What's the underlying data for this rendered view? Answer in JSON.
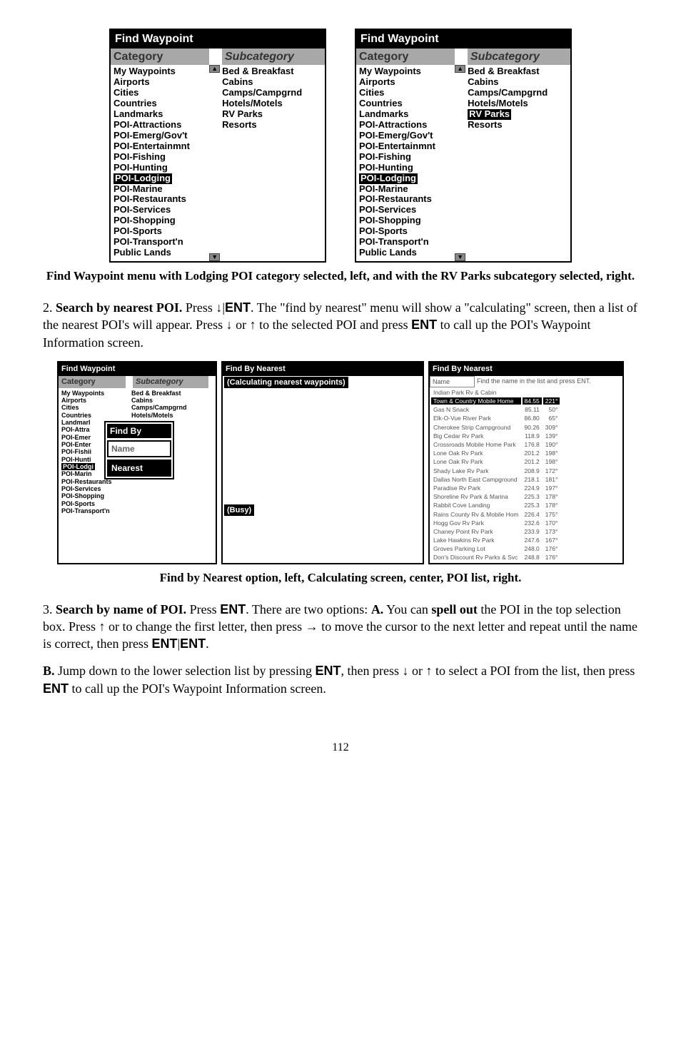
{
  "figure1": {
    "windows": [
      {
        "title": "Find Waypoint",
        "cat_header": "Category",
        "sub_header": "Subcategory",
        "categories": [
          "My Waypoints",
          "Airports",
          "Cities",
          "Countries",
          "Landmarks",
          "POI-Attractions",
          "POI-Emerg/Gov't",
          "POI-Entertainmnt",
          "POI-Fishing",
          "POI-Hunting",
          "POI-Lodging",
          "POI-Marine",
          "POI-Restaurants",
          "POI-Services",
          "POI-Shopping",
          "POI-Sports",
          "POI-Transport'n",
          "Public Lands"
        ],
        "cat_selected_index": 10,
        "subcategories": [
          "Bed & Breakfast",
          "Cabins",
          "Camps/Campgrnd",
          "Hotels/Motels",
          "RV Parks",
          "Resorts"
        ],
        "sub_selected_index": -1
      },
      {
        "title": "Find Waypoint",
        "cat_header": "Category",
        "sub_header": "Subcategory",
        "categories": [
          "My Waypoints",
          "Airports",
          "Cities",
          "Countries",
          "Landmarks",
          "POI-Attractions",
          "POI-Emerg/Gov't",
          "POI-Entertainmnt",
          "POI-Fishing",
          "POI-Hunting",
          "POI-Lodging",
          "POI-Marine",
          "POI-Restaurants",
          "POI-Services",
          "POI-Shopping",
          "POI-Sports",
          "POI-Transport'n",
          "Public Lands"
        ],
        "cat_selected_index": 10,
        "subcategories": [
          "Bed & Breakfast",
          "Cabins",
          "Camps/Campgrnd",
          "Hotels/Motels",
          "RV Parks",
          "Resorts"
        ],
        "sub_selected_index": 4
      }
    ],
    "caption": "Find Waypoint menu with Lodging POI category selected, left, and with the RV Parks subcategory selected, right."
  },
  "para1_before": "2. ",
  "para1_bold": "Search by nearest POI.",
  "para1_after1": " Press ↓|",
  "para1_ent1": "ENT",
  "para1_after2": ". The \"find by nearest\" menu will show a \"calculating\" screen, then a list of the nearest POI's will appear. Press ↓ or ↑ to the selected POI and press ",
  "para1_ent2": "ENT",
  "para1_after3": " to call up the POI's Waypoint Information screen.",
  "figure2": {
    "left": {
      "title": "Find Waypoint",
      "cat_header": "Category",
      "sub_header": "Subcategory",
      "categories": [
        "My Waypoints",
        "Airports",
        "Cities",
        "Countries",
        "Landmarl",
        "POI-Attra",
        "POI-Emer",
        "POI-Enter",
        "POI-Fishii",
        "POI-Hunti",
        "POI-Lodgi",
        "POI-Marin",
        "POI-Restaurants",
        "POI-Services",
        "POI-Shopping",
        "POI-Sports",
        "POI-Transport'n",
        "Public Lands"
      ],
      "subcategories": [
        "Bed & Breakfast",
        "Cabins",
        "Camps/Campgrnd",
        "Hotels/Motels"
      ],
      "popup_title": "Find By",
      "popup_items": [
        "Name",
        "Nearest"
      ],
      "popup_selected": 1
    },
    "center": {
      "title": "Find By Nearest",
      "status": "(Calculating nearest waypoints)",
      "busy": "(Busy)"
    },
    "right": {
      "title": "Find By Nearest",
      "name_label": "Name",
      "hint": "Find the name in the list and press ENT.",
      "rows": [
        {
          "name": "Indian Park Rv & Cabin",
          "dist": "",
          "brg": ""
        },
        {
          "name": "Town & Country Mobile Home",
          "dist": "84.55",
          "brg": "221°",
          "sel": true
        },
        {
          "name": "Gas N Snack",
          "dist": "85.11",
          "brg": "50°"
        },
        {
          "name": "Elk-O-Vue River Park",
          "dist": "86.80",
          "brg": "65°"
        },
        {
          "name": "Cherokee Strip Campground",
          "dist": "90.26",
          "brg": "309°"
        },
        {
          "name": "Big Cedar Rv Park",
          "dist": "118.9",
          "brg": "139°"
        },
        {
          "name": "Crossroads Mobile Home Park",
          "dist": "176.8",
          "brg": "190°"
        },
        {
          "name": "Lone Oak Rv Park",
          "dist": "201.2",
          "brg": "198°"
        },
        {
          "name": "Lone Oak Rv Park",
          "dist": "201.2",
          "brg": "198°"
        },
        {
          "name": "Shady Lake Rv Park",
          "dist": "208.9",
          "brg": "172°"
        },
        {
          "name": "Dallas North East Campground",
          "dist": "218.1",
          "brg": "181°"
        },
        {
          "name": "Paradise Rv Park",
          "dist": "224.9",
          "brg": "197°"
        },
        {
          "name": "Shoreline Rv Park & Marina",
          "dist": "225.3",
          "brg": "178°"
        },
        {
          "name": "Rabbit Cove Landing",
          "dist": "225.3",
          "brg": "178°"
        },
        {
          "name": "Rains County Rv & Mobile Hom",
          "dist": "226.4",
          "brg": "175°"
        },
        {
          "name": "Hogg Gov Rv Park",
          "dist": "232.6",
          "brg": "170°"
        },
        {
          "name": "Chaney Point Rv Park",
          "dist": "233.9",
          "brg": "173°"
        },
        {
          "name": "Lake Hawkins Rv Park",
          "dist": "247.6",
          "brg": "167°"
        },
        {
          "name": "Groves Parking Lot",
          "dist": "248.0",
          "brg": "176°"
        },
        {
          "name": "Don's Discount Rv Parks & Svc",
          "dist": "248.8",
          "brg": "176°"
        }
      ]
    },
    "caption": "Find by Nearest option, left, Calculating screen, center, POI list, right."
  },
  "para2_before": "3. ",
  "para2_bold": "Search by name of POI.",
  "para2_after1": " Press ",
  "para2_ent1": "ENT",
  "para2_after2": ". There are two options: ",
  "para2_boldA": "A.",
  "para2_after3": " You can ",
  "para2_bold_spell": "spell out",
  "para2_after4": " the POI in the top selection box. Press ↑ or to change the first letter, then press → to move the cursor to the next letter and repeat until the name is correct, then press ",
  "para2_ent2": "ENT",
  "para2_sep": "|",
  "para2_ent3": "ENT",
  "para2_after5": ".",
  "para3_boldB": "B.",
  "para3_after1": " Jump down to the lower selection list by pressing ",
  "para3_ent1": "ENT",
  "para3_after2": ", then press ↓ or ↑ to select a POI from the list, then press ",
  "para3_ent2": "ENT",
  "para3_after3": " to call up the POI's Waypoint Information screen.",
  "pagenum": "112"
}
